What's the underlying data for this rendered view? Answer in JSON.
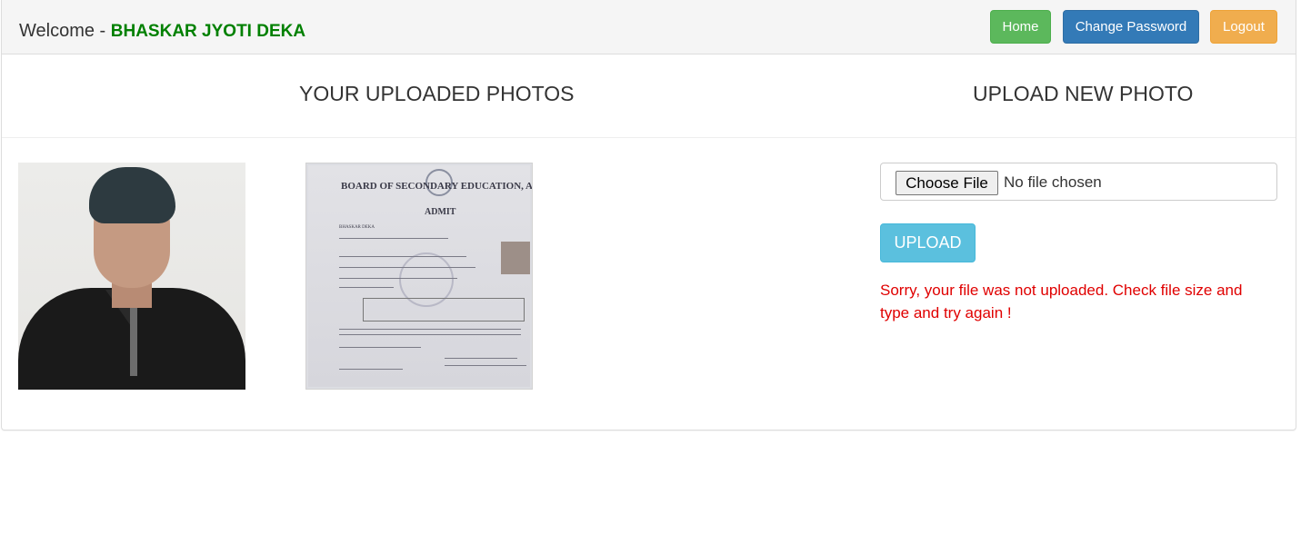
{
  "header": {
    "welcome_prefix": "Welcome - ",
    "user_name": "BHASKAR JYOTI DEKA",
    "buttons": {
      "home": "Home",
      "change_password": "Change Password",
      "logout": "Logout"
    }
  },
  "sections": {
    "uploaded_title": "YOUR UPLOADED PHOTOS",
    "upload_title": "UPLOAD NEW PHOTO"
  },
  "photos": [
    {
      "kind": "portrait-photo"
    },
    {
      "kind": "admit-card-scan",
      "lines": {
        "title": "BOARD OF SECONDARY EDUCATION, ASSAM",
        "heading": "ADMIT",
        "name": "BHASKAR DEKA"
      }
    }
  ],
  "upload": {
    "choose_file_label": "Choose File",
    "file_status": "No file chosen",
    "upload_label": "UPLOAD",
    "error_message": "Sorry, your file was not uploaded. Check file size and type and try again !"
  },
  "colors": {
    "user_name": "#008000",
    "home": "#5cb85c",
    "change_password": "#337ab7",
    "logout": "#f0ad4e",
    "upload": "#5bc0de",
    "error": "#e00000"
  }
}
